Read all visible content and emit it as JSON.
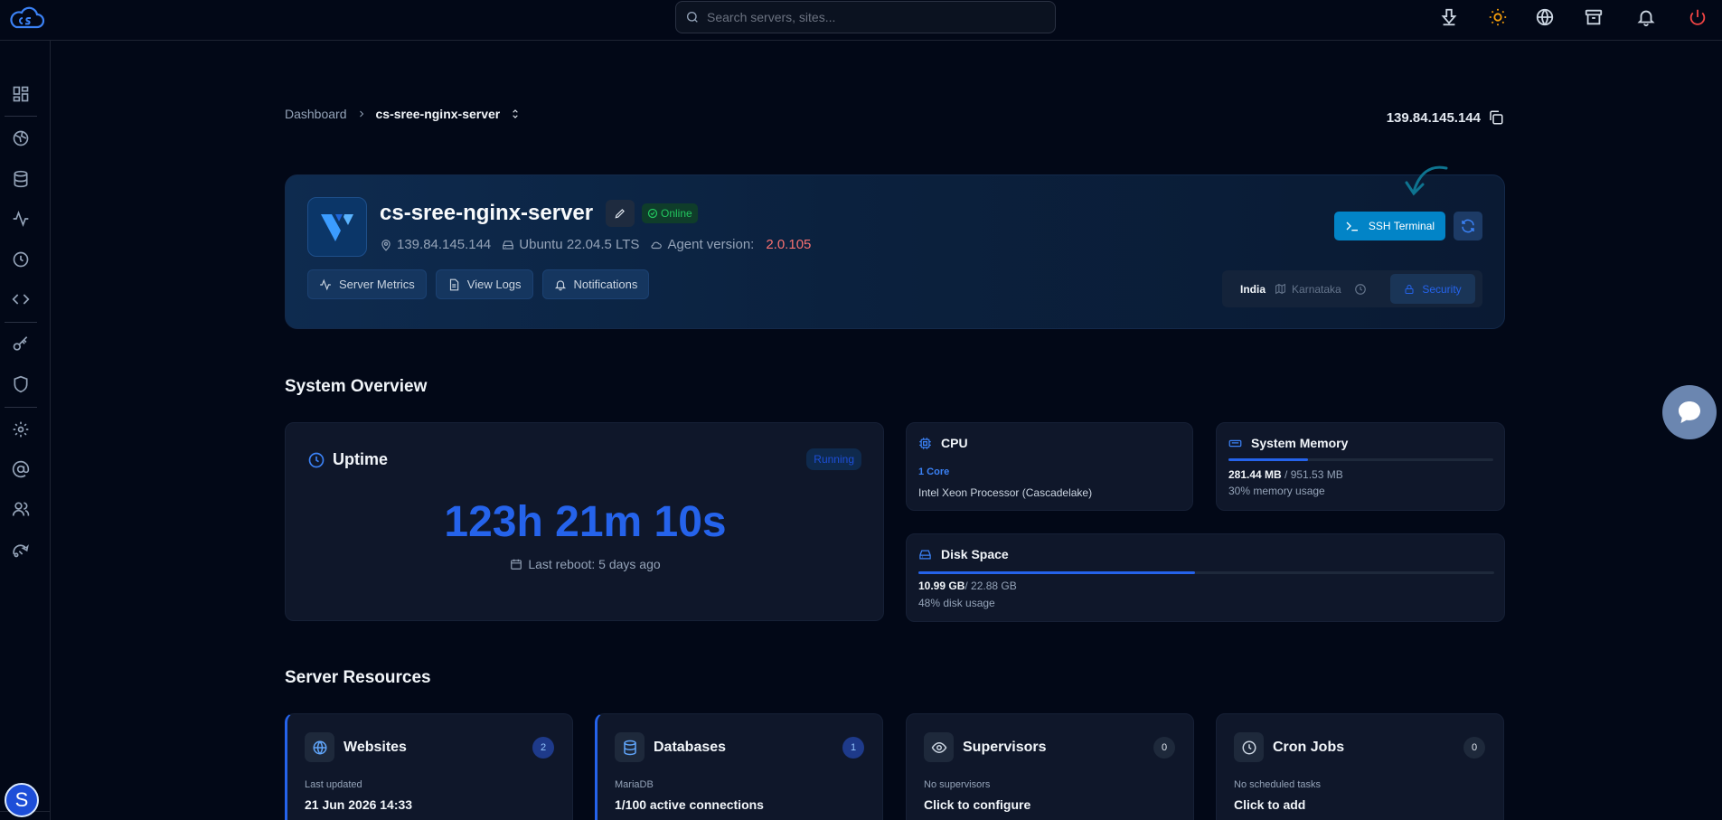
{
  "colors": {
    "background": "#020817",
    "accent": "#2563eb",
    "online": "#22c55e",
    "agent_version": "#f87171",
    "ssh_button": "#0284c7"
  },
  "topbar": {
    "logo_icon": "cs-cloud-logo-icon",
    "search_placeholder": "Search servers, sites...",
    "icons": [
      "download-icon",
      "sun-icon",
      "globe-icon",
      "archive-icon",
      "bell-icon",
      "power-icon"
    ]
  },
  "sidebar": {
    "icons": [
      "dashboard-icon",
      "websites-icon",
      "databases-icon",
      "activity-icon",
      "clock-icon",
      "code-icon",
      "key-icon",
      "shield-icon",
      "settings-icon",
      "at-sign-icon",
      "users-icon",
      "deploy-icon"
    ],
    "avatar_letter": "S"
  },
  "breadcrumb": {
    "root": "Dashboard",
    "current": "cs-sree-nginx-server"
  },
  "server": {
    "ip": "139.84.145.144",
    "name": "cs-sree-nginx-server",
    "status": "Online",
    "os": "Ubuntu 22.04.5 LTS",
    "agent_label": "Agent version:",
    "agent_version": "2.0.105",
    "actions": {
      "metrics": "Server Metrics",
      "logs": "View Logs",
      "notifications": "Notifications"
    },
    "ssh_label": "SSH Terminal",
    "location": {
      "country": "India",
      "region": "Karnataka"
    },
    "security_label": "Security"
  },
  "overview": {
    "title": "System Overview",
    "uptime": {
      "title": "Uptime",
      "badge": "Running",
      "value": "123h 21m 10s",
      "last_reboot": "Last reboot: 5 days ago"
    },
    "cpu": {
      "title": "CPU",
      "cores": "1 Core",
      "model": "Intel Xeon Processor (Cascadelake)"
    },
    "memory": {
      "title": "System Memory",
      "used": "281.44 MB",
      "total": " / 951.53 MB",
      "percent_text": "30% memory usage",
      "fraction": 0.3
    },
    "disk": {
      "title": "Disk Space",
      "used": "10.99 GB",
      "total": "/ 22.88 GB",
      "percent_text": "48% disk usage",
      "fraction": 0.48
    }
  },
  "resources": {
    "title": "Server Resources",
    "cards": [
      {
        "title": "Websites",
        "count": "2",
        "sub": "Last updated",
        "main": "21 Jun 2026 14:33",
        "icon": "globe-icon"
      },
      {
        "title": "Databases",
        "count": "1",
        "sub": "MariaDB",
        "main": "1/100 active connections",
        "icon": "database-icon"
      },
      {
        "title": "Supervisors",
        "count": "0",
        "sub": "No supervisors",
        "main": "Click to configure",
        "icon": "eye-icon"
      },
      {
        "title": "Cron Jobs",
        "count": "0",
        "sub": "No scheduled tasks",
        "main": "Click to add",
        "icon": "clock-icon"
      }
    ]
  },
  "chat": {
    "icon": "chat-bubble-icon"
  }
}
